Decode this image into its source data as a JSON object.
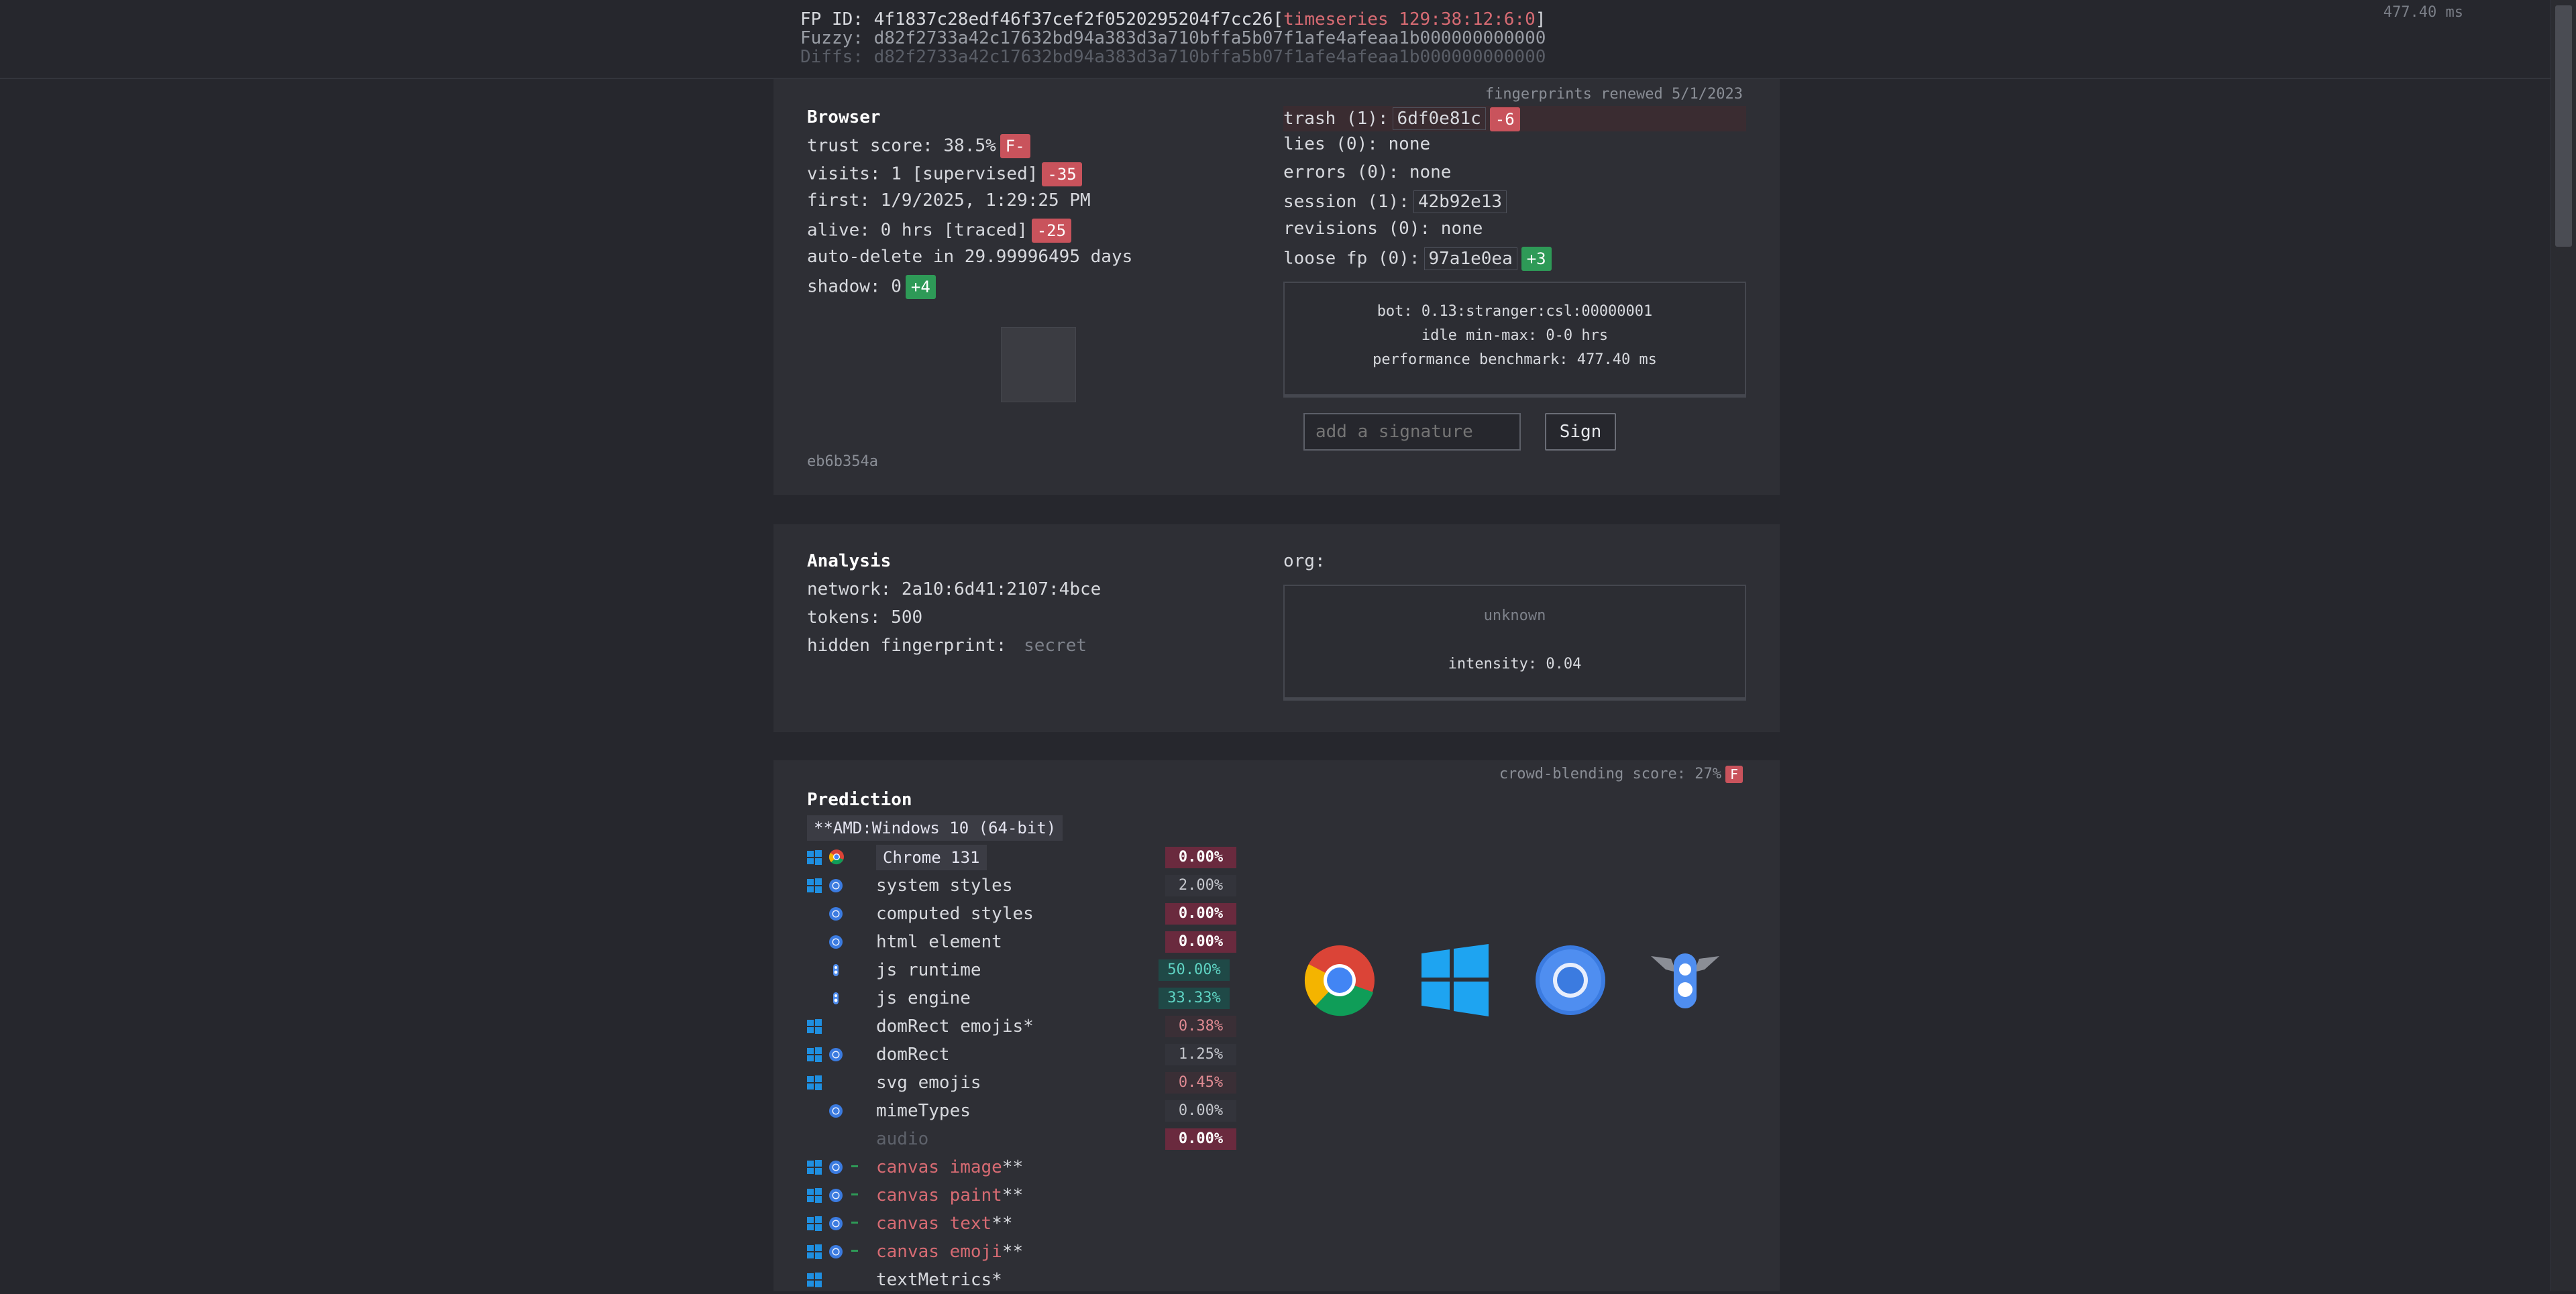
{
  "header": {
    "fp_id_label": "FP ID:",
    "fp_id_value": "4f1837c28edf46f37cef2f0520295204f7cc26",
    "timeseries_label": "timeseries 129:38:12:6:0",
    "fuzzy_label": "Fuzzy:",
    "fuzzy_value": "d82f2733a42c17632bd94a383d3a710bffa5b07f1afe4afeaa1b000000000000",
    "diffs_label": "Diffs:",
    "diffs_value": "d82f2733a42c17632bd94a383d3a710bffa5b07f1afe4afeaa1b000000000000",
    "timing": "477.40 ms"
  },
  "browser": {
    "title": "Browser",
    "renewed": "fingerprints renewed 5/1/2023",
    "trust_score": "trust score: 38.5%",
    "trust_grade": "F-",
    "visits": "visits: 1 [supervised]",
    "visits_delta": "-35",
    "first": "first: 1/9/2025, 1:29:25 PM",
    "alive": "alive: 0 hrs [traced]",
    "alive_delta": "-25",
    "auto_delete": "auto-delete in 29.99996495 days",
    "shadow": "shadow: 0",
    "shadow_delta": "+4",
    "hash": "eb6b354a",
    "trash_label": "trash (1):",
    "trash_hash": "6df0e81c",
    "trash_delta": "-6",
    "lies": "lies (0): none",
    "errors": "errors (0): none",
    "session_label": "session (1):",
    "session_hash": "42b92e13",
    "revisions": "revisions (0): none",
    "loose_label": "loose fp (0):",
    "loose_hash": "97a1e0ea",
    "loose_delta": "+3",
    "bot": "bot: 0.13:stranger:csl:00000001",
    "idle": "idle min-max: 0-0 hrs",
    "benchmark": "performance benchmark: 477.40 ms",
    "signature_placeholder": "add a signature",
    "sign_label": "Sign"
  },
  "analysis": {
    "title": "Analysis",
    "network": "network: 2a10:6d41:2107:4bce",
    "tokens": "tokens: 500",
    "hidden_label": "hidden fingerprint:",
    "hidden_value": "secret",
    "org_label": "org:",
    "unknown": "unknown",
    "intensity": "intensity: 0.04"
  },
  "prediction": {
    "title": "Prediction",
    "crowd": "crowd-blending score: 27%",
    "crowd_grade": "F",
    "os": "**AMD:Windows 10 (64-bit)",
    "browser_chip": "Chrome 131",
    "rows": [
      {
        "label": "system styles",
        "pct": "2.00%",
        "kind": "mid"
      },
      {
        "label": "computed styles",
        "pct": "0.00%",
        "kind": "hi"
      },
      {
        "label": "html element",
        "pct": "0.00%",
        "kind": "hi"
      },
      {
        "label": "js runtime",
        "pct": "50.00%",
        "kind": "teal"
      },
      {
        "label": "js engine",
        "pct": "33.33%",
        "kind": "teal"
      },
      {
        "label": "domRect emojis*",
        "pct": "0.38%",
        "kind": "low"
      },
      {
        "label": "domRect",
        "pct": "1.25%",
        "kind": "mid"
      },
      {
        "label": "svg emojis",
        "pct": "0.45%",
        "kind": "low"
      },
      {
        "label": "mimeTypes",
        "pct": "0.00%",
        "kind": "mid"
      },
      {
        "label": "audio",
        "pct": "0.00%",
        "kind": "hi"
      },
      {
        "label": "canvas image",
        "suffix": "**"
      },
      {
        "label": "canvas paint",
        "suffix": "**"
      },
      {
        "label": "canvas text",
        "suffix": "**"
      },
      {
        "label": "canvas emoji",
        "suffix": "**"
      },
      {
        "label": "textMetrics*",
        "suffix": ""
      }
    ],
    "chrome_pct": "0.00%"
  },
  "colors": {
    "background": "#26272d",
    "card": "#2e2f35",
    "danger": "#c9535c",
    "success": "#2e9a57",
    "teal": "#5fd4c4"
  },
  "icons": [
    "windows-icon",
    "chrome-icon",
    "chromium-icon",
    "v8-icon"
  ]
}
